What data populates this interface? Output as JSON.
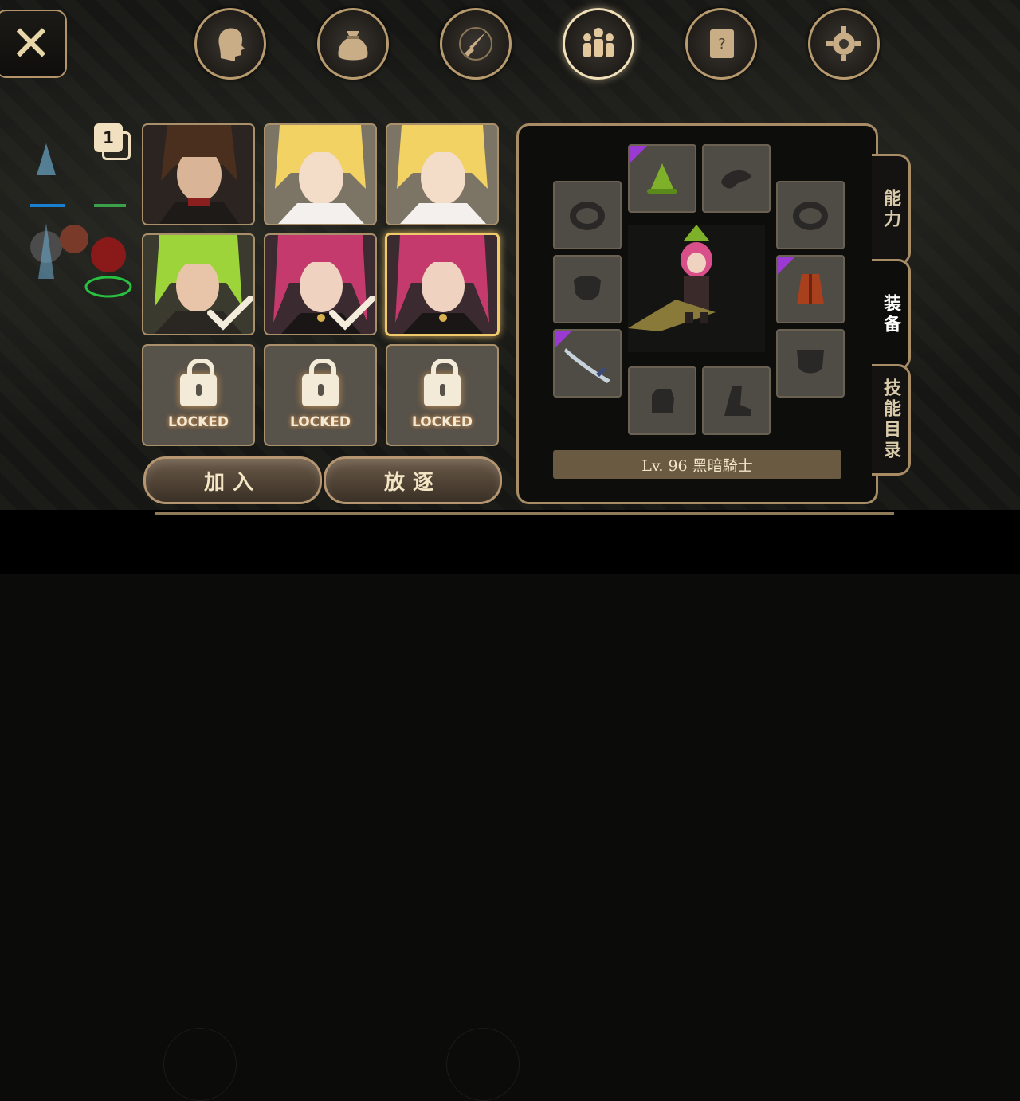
{
  "top_nav": {
    "items": [
      {
        "icon": "head-icon"
      },
      {
        "icon": "bag-icon"
      },
      {
        "icon": "compass-sword-icon"
      },
      {
        "icon": "party-icon",
        "active": true
      },
      {
        "icon": "quest-scroll-icon"
      },
      {
        "icon": "gear-icon"
      }
    ]
  },
  "close_label": "✕",
  "page_badge": "1",
  "party": {
    "slots": [
      {
        "character": "brown-haired-swordsman",
        "selected": false,
        "checked": false,
        "locked": false
      },
      {
        "character": "blonde-priestess",
        "selected": false,
        "checked": false,
        "locked": false
      },
      {
        "character": "blonde-priestess",
        "selected": false,
        "checked": false,
        "locked": false
      },
      {
        "character": "green-haired-rogue",
        "selected": false,
        "checked": true,
        "locked": false
      },
      {
        "character": "pink-haired-dark-knight",
        "selected": false,
        "checked": true,
        "locked": false
      },
      {
        "character": "pink-haired-dark-knight",
        "selected": true,
        "checked": false,
        "locked": false
      },
      {
        "locked": true,
        "label": "LOCKED"
      },
      {
        "locked": true,
        "label": "LOCKED"
      },
      {
        "locked": true,
        "label": "LOCKED"
      }
    ]
  },
  "buttons": {
    "join": "加入",
    "kick": "放逐"
  },
  "equipment": {
    "level_label": "Lv. 96 黑暗騎士",
    "rarity_color": "#9b3ad3",
    "slots": [
      {
        "name": "helmet",
        "icon": "green-hat-icon",
        "rare": true
      },
      {
        "name": "cape",
        "icon": "cape-icon",
        "rare": false
      },
      {
        "name": "ring-left",
        "icon": "ring-icon",
        "rare": false
      },
      {
        "name": "ring-right",
        "icon": "ring-icon",
        "rare": false
      },
      {
        "name": "armor",
        "icon": "armor-icon",
        "rare": false
      },
      {
        "name": "body",
        "icon": "red-coat-icon",
        "rare": true
      },
      {
        "name": "weapon",
        "icon": "sword-icon",
        "rare": true
      },
      {
        "name": "shield",
        "icon": "shield-icon",
        "rare": false
      },
      {
        "name": "gloves",
        "icon": "glove-icon",
        "rare": false
      },
      {
        "name": "boots",
        "icon": "boot-icon",
        "rare": false
      }
    ]
  },
  "side_tabs": [
    {
      "label": "能力",
      "active": false
    },
    {
      "label": "装备",
      "active": true
    },
    {
      "label": "技能目录",
      "active": false
    }
  ]
}
